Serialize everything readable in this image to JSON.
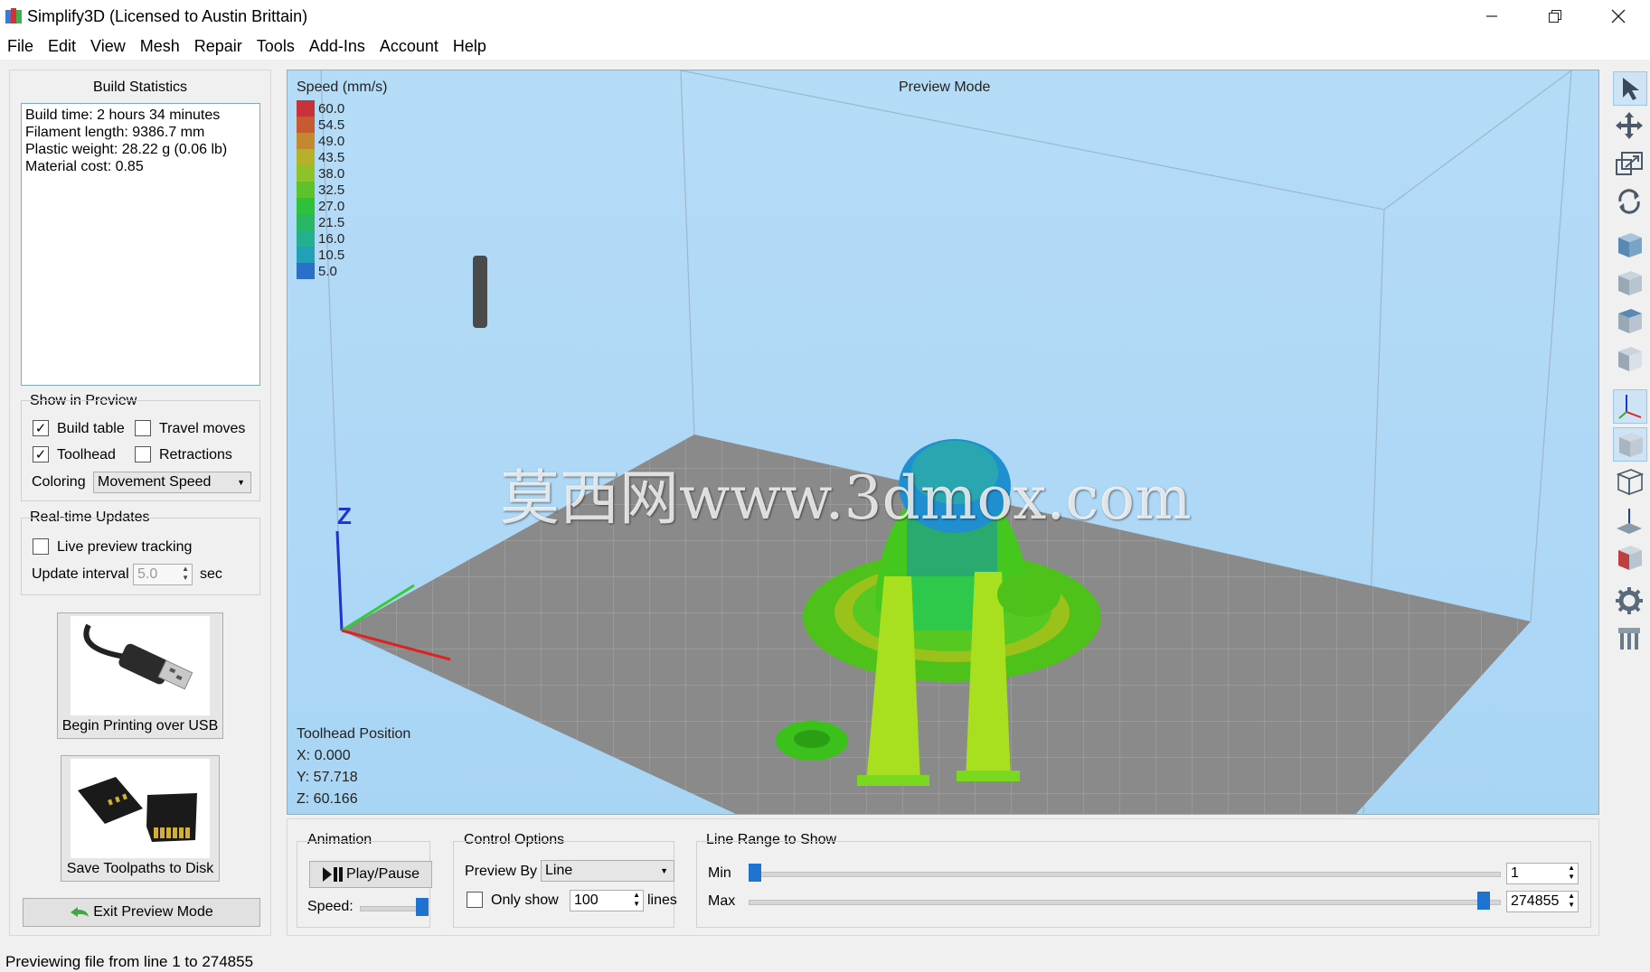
{
  "window": {
    "title": "Simplify3D (Licensed to Austin Brittain)"
  },
  "menu": [
    "File",
    "Edit",
    "View",
    "Mesh",
    "Repair",
    "Tools",
    "Add-Ins",
    "Account",
    "Help"
  ],
  "build_stats": {
    "heading": "Build Statistics",
    "lines": [
      "Build time: 2 hours 34 minutes",
      "Filament length: 9386.7 mm",
      "Plastic weight: 28.22 g (0.06 lb)",
      "Material cost: 0.85"
    ]
  },
  "show_in_preview": {
    "heading": "Show in Preview",
    "build_table": {
      "label": "Build table",
      "checked": true
    },
    "travel_moves": {
      "label": "Travel moves",
      "checked": false
    },
    "toolhead": {
      "label": "Toolhead",
      "checked": true
    },
    "retractions": {
      "label": "Retractions",
      "checked": false
    },
    "coloring_label": "Coloring",
    "coloring_value": "Movement Speed"
  },
  "realtime": {
    "heading": "Real-time Updates",
    "live_tracking": {
      "label": "Live preview tracking",
      "checked": false
    },
    "interval_label": "Update interval",
    "interval_value": "5.0",
    "interval_unit": "sec"
  },
  "buttons": {
    "usb": "Begin Printing over USB",
    "disk": "Save Toolpaths to Disk",
    "exit": "Exit Preview Mode"
  },
  "viewport": {
    "legend_title": "Speed (mm/s)",
    "mode": "Preview Mode",
    "legend": [
      {
        "value": "60.0",
        "color": "#c8323a"
      },
      {
        "value": "54.5",
        "color": "#c85a32"
      },
      {
        "value": "49.0",
        "color": "#c4892e"
      },
      {
        "value": "43.5",
        "color": "#b5b22a"
      },
      {
        "value": "38.0",
        "color": "#8ec22a"
      },
      {
        "value": "32.5",
        "color": "#5ec22a"
      },
      {
        "value": "27.0",
        "color": "#2ec23a"
      },
      {
        "value": "21.5",
        "color": "#28b864"
      },
      {
        "value": "16.0",
        "color": "#22b08e"
      },
      {
        "value": "10.5",
        "color": "#22a0b8"
      },
      {
        "value": "5.0",
        "color": "#2a70c8"
      }
    ],
    "axis_z": "Z",
    "watermark": "莫西网www.3dmox.com",
    "toolhead": {
      "heading": "Toolhead Position",
      "x": "X: 0.000",
      "y": "Y: 57.718",
      "z": "Z: 60.166"
    }
  },
  "animation": {
    "heading": "Animation",
    "play": "Play/Pause",
    "speed_label": "Speed:",
    "speed_level": 1.0
  },
  "control": {
    "heading": "Control Options",
    "preview_by_label": "Preview By",
    "preview_by_value": "Line",
    "only_show": {
      "label": "Only show",
      "checked": false
    },
    "only_show_value": "100",
    "lines_unit": "lines"
  },
  "line_range": {
    "heading": "Line Range to Show",
    "min_label": "Min",
    "max_label": "Max",
    "min_value": "1",
    "max_value": "274855"
  },
  "status": "Previewing file from line 1 to 274855"
}
